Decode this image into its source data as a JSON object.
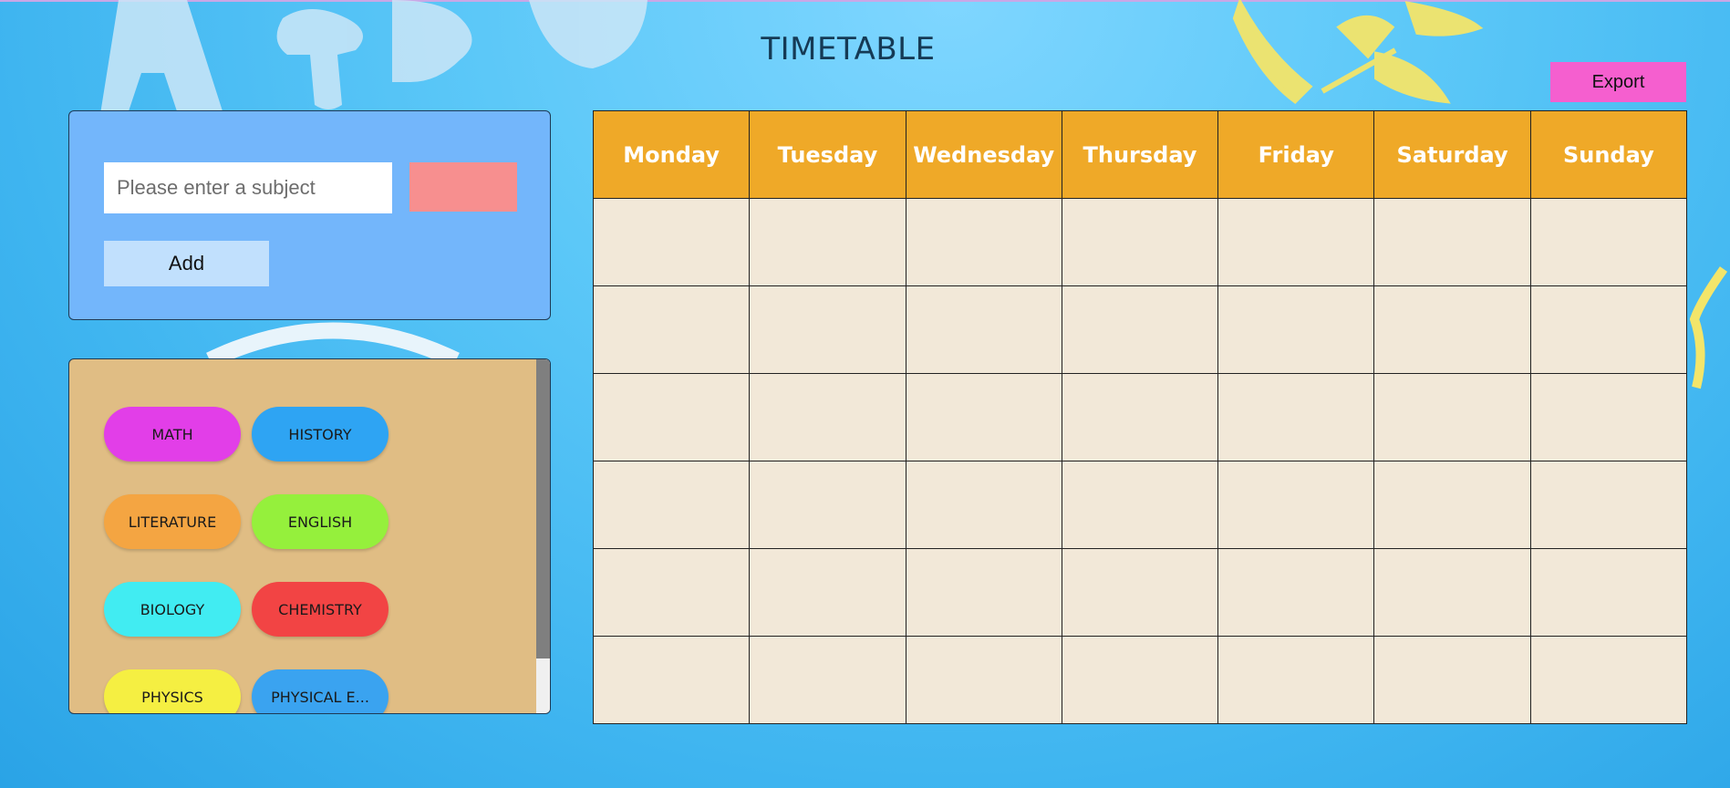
{
  "page": {
    "title": "TIMETABLE"
  },
  "toolbar": {
    "export_label": "Export"
  },
  "subject_form": {
    "placeholder": "Please enter a subject",
    "value": "",
    "selected_color": "#f78f8f",
    "add_label": "Add"
  },
  "subjects": [
    {
      "label": "MATH",
      "color": "#e23ee8"
    },
    {
      "label": "HISTORY",
      "color": "#2ea4f3"
    },
    {
      "label": "LITERATURE",
      "color": "#f4a542"
    },
    {
      "label": "ENGLISH",
      "color": "#95f03c"
    },
    {
      "label": "BIOLOGY",
      "color": "#41ecf2"
    },
    {
      "label": "CHEMISTRY",
      "color": "#f24444"
    },
    {
      "label": "PHYSICS",
      "color": "#f5ef42"
    },
    {
      "label": "PHYSICAL E...",
      "color": "#3aa3f0"
    }
  ],
  "timetable": {
    "days": [
      "Monday",
      "Tuesday",
      "Wednesday",
      "Thursday",
      "Friday",
      "Saturday",
      "Sunday"
    ],
    "header_color": "#efa928",
    "cell_color": "#f2e8d8",
    "rows": [
      [
        "",
        "",
        "",
        "",
        "",
        "",
        ""
      ],
      [
        "",
        "",
        "",
        "",
        "",
        "",
        ""
      ],
      [
        "",
        "",
        "",
        "",
        "",
        "",
        ""
      ],
      [
        "",
        "",
        "",
        "",
        "",
        "",
        ""
      ],
      [
        "",
        "",
        "",
        "",
        "",
        "",
        ""
      ],
      [
        "",
        "",
        "",
        "",
        "",
        "",
        ""
      ]
    ]
  }
}
